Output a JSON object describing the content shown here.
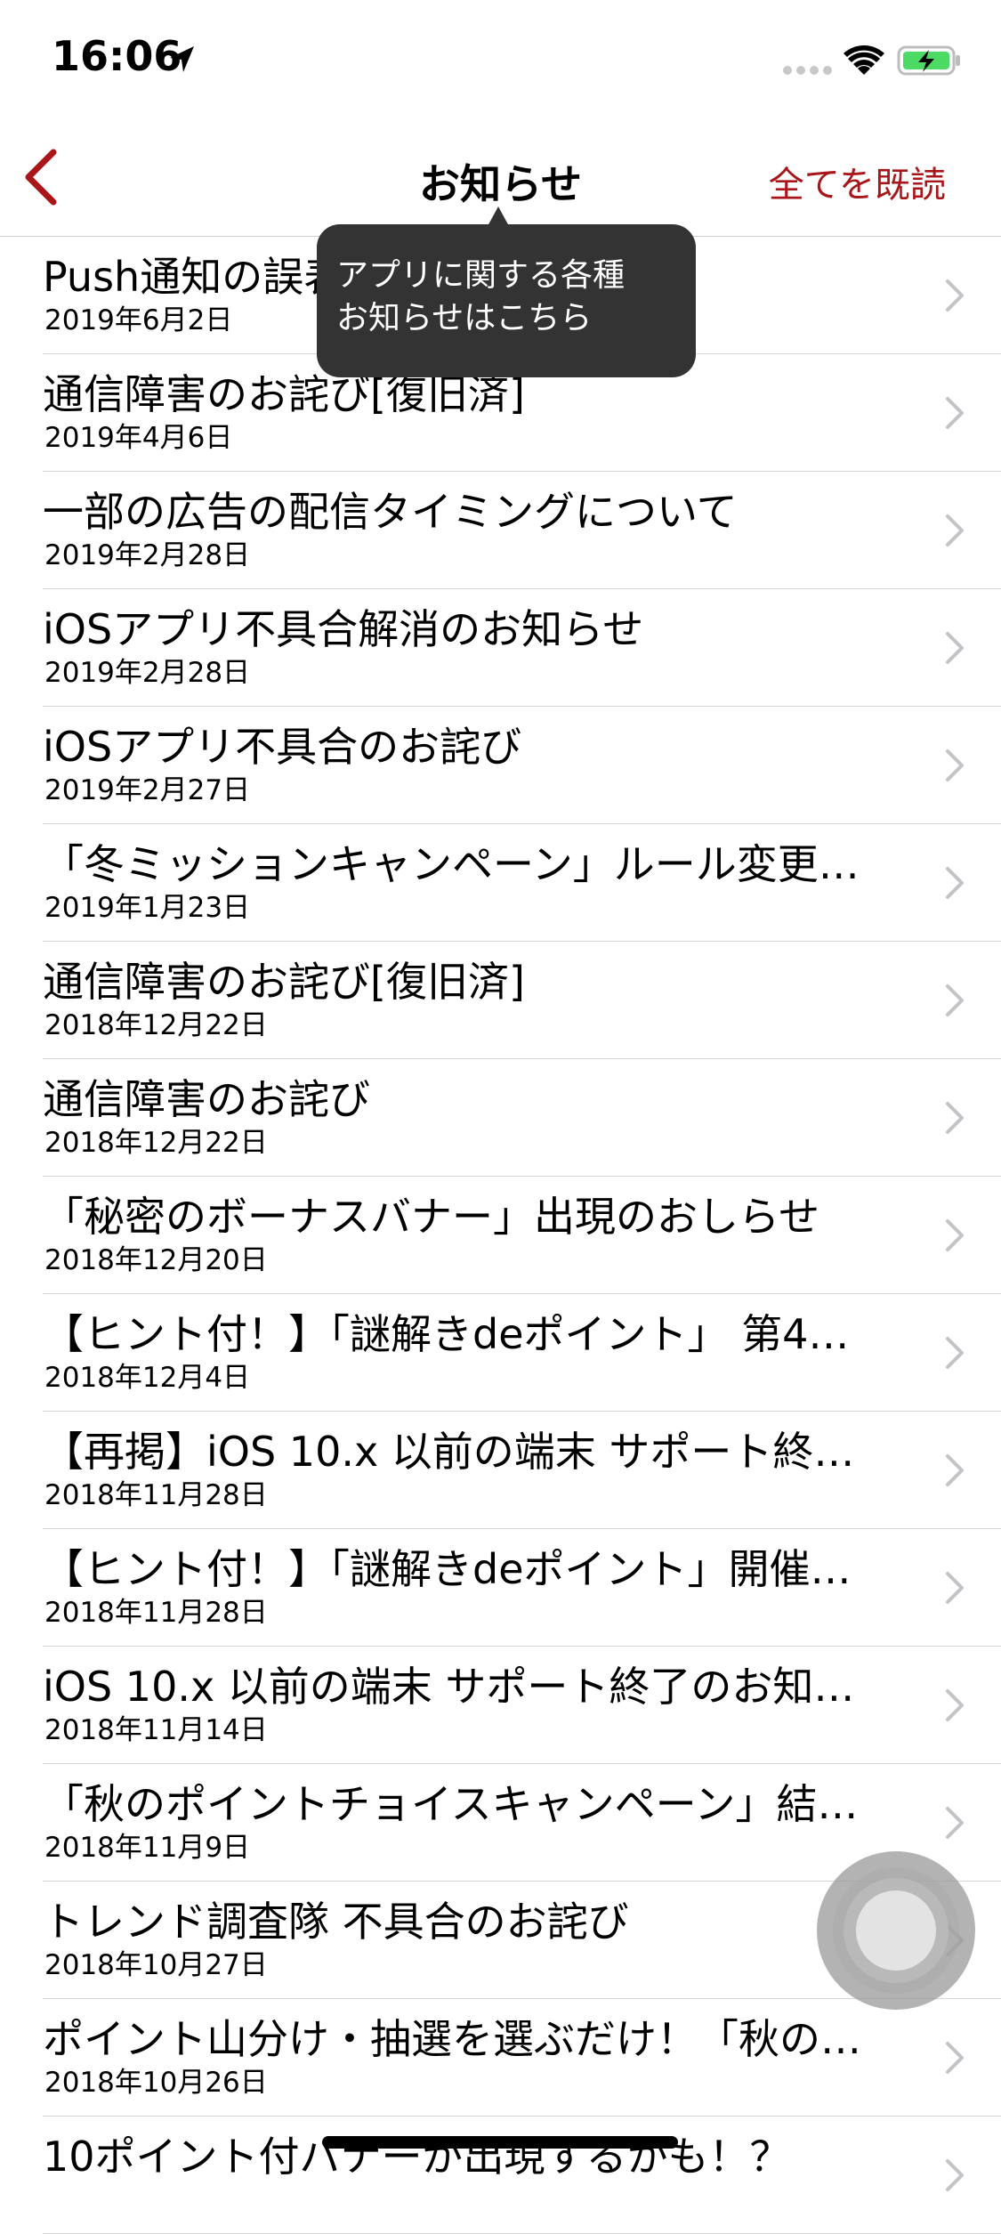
{
  "status_bar": {
    "time": "16:06"
  },
  "nav": {
    "title": "お知らせ",
    "mark_all_read": "全てを既読",
    "back_icon": "chevron-left-icon"
  },
  "tooltip": {
    "line1": "アプリに関する各種",
    "line2": "お知らせはこちら"
  },
  "notices": [
    {
      "title": "Push通知の誤表記のお詫び",
      "date": "2019年6月2日"
    },
    {
      "title": "通信障害のお詫び[復旧済]",
      "date": "2019年4月6日"
    },
    {
      "title": "一部の広告の配信タイミングについて",
      "date": "2019年2月28日"
    },
    {
      "title": "iOSアプリ不具合解消のお知らせ",
      "date": "2019年2月28日"
    },
    {
      "title": "iOSアプリ不具合のお詫び",
      "date": "2019年2月27日"
    },
    {
      "title": "「冬ミッションキャンペーン」ルール変更…",
      "date": "2019年1月23日"
    },
    {
      "title": "通信障害のお詫び[復旧済]",
      "date": "2018年12月22日"
    },
    {
      "title": "通信障害のお詫び",
      "date": "2018年12月22日"
    },
    {
      "title": "「秘密のボーナスバナー」出現のおしらせ",
      "date": "2018年12月20日"
    },
    {
      "title": "【ヒント付！】「謎解きdeポイント」 第4…",
      "date": "2018年12月4日"
    },
    {
      "title": "【再掲】iOS 10.x 以前の端末 サポート終…",
      "date": "2018年11月28日"
    },
    {
      "title": "【ヒント付！】「謎解きdeポイント」開催…",
      "date": "2018年11月28日"
    },
    {
      "title": "iOS 10.x 以前の端末 サポート終了のお知…",
      "date": "2018年11月14日"
    },
    {
      "title": "「秋のポイントチョイスキャンペーン」結…",
      "date": "2018年11月9日"
    },
    {
      "title": "トレンド調査隊 不具合のお詫び",
      "date": "2018年10月27日"
    },
    {
      "title": "ポイント山分け・抽選を選ぶだけ！「秋の…",
      "date": "2018年10月26日"
    },
    {
      "title": "10ポイント付バナーが出現するかも！？",
      "date": ""
    }
  ],
  "colors": {
    "accent": "#a8161a",
    "tooltip_bg": "#333333",
    "separator": "#d6d6d6",
    "chevron": "#c4c4c8",
    "battery_fill": "#4cd964"
  }
}
